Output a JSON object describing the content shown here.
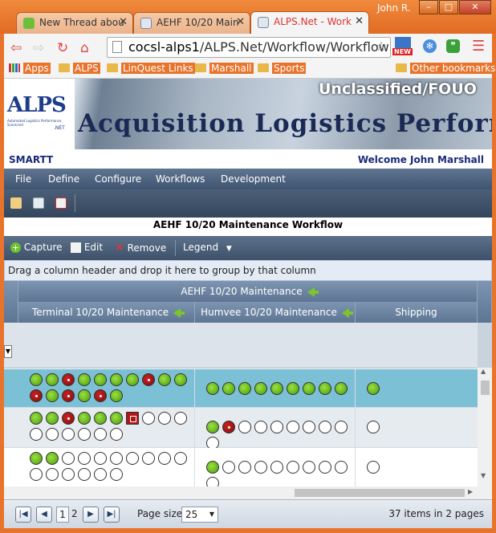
{
  "window": {
    "user": "John R.",
    "tabs": [
      {
        "title": "New Thread abou",
        "active": false
      },
      {
        "title": "AEHF 10/20 Main",
        "active": false
      },
      {
        "title": "ALPS.Net - Work",
        "active": true
      }
    ],
    "buttons": {
      "minimize": "–",
      "maximize": "□",
      "close": "✕"
    }
  },
  "browser": {
    "url_host": "cocsl-alps1",
    "url_path": "/ALPS.Net/Workflow/WorkflowP",
    "bookmarks": [
      "Apps",
      "ALPS",
      "LinQuest Links",
      "Marshall",
      "Sports"
    ],
    "other_bookmarks": "Other bookmarks",
    "new_badge": "NEW"
  },
  "banner": {
    "logo_text": "ALPS",
    "logo_sub": "Automated Logistics Performance Scorecard",
    "logo_net": ".NET",
    "classification": "Unclassified/FOUO",
    "title": "Acquisition Logistics Performa"
  },
  "app": {
    "name": "SMARTT",
    "welcome": "Welcome John Marshall"
  },
  "menu": [
    "File",
    "Define",
    "Configure",
    "Workflows",
    "Development"
  ],
  "workflow_title": "AEHF 10/20 Maintenance Workflow",
  "commands": {
    "capture": "Capture",
    "edit": "Edit",
    "remove": "Remove",
    "legend": "Legend"
  },
  "group_hint": "Drag a column header and drop it here to group by that column",
  "grid": {
    "group_header": "AEHF 10/20 Maintenance",
    "columns": [
      "Terminal 10/20 Maintenance",
      "Humvee 10/20 Maintenance",
      "Shipping"
    ],
    "rows": [
      {
        "selected": true,
        "terminal": [
          "g",
          "g",
          "r",
          "g",
          "g",
          "g",
          "g",
          "r",
          "g",
          "g",
          "r",
          "g",
          "r",
          "g",
          "r",
          "g"
        ],
        "humvee": [
          "g",
          "g",
          "g",
          "g",
          "g",
          "g",
          "g",
          "g",
          "g"
        ],
        "shipping": [
          "g"
        ]
      },
      {
        "selected": false,
        "terminal": [
          "g",
          "g",
          "r",
          "g",
          "g",
          "g",
          "sq",
          "w",
          "w",
          "w",
          "w",
          "w",
          "w",
          "w",
          "w",
          "w"
        ],
        "humvee": [
          "g",
          "r",
          "w",
          "w",
          "w",
          "w",
          "w",
          "w",
          "w",
          "w"
        ],
        "shipping": [
          "w"
        ]
      },
      {
        "selected": false,
        "terminal": [
          "g",
          "g",
          "w",
          "w",
          "w",
          "w",
          "w",
          "w",
          "w",
          "w",
          "w",
          "w",
          "w",
          "w",
          "w",
          "w"
        ],
        "humvee": [
          "g",
          "w",
          "w",
          "w",
          "w",
          "w",
          "w",
          "w",
          "w",
          "w"
        ],
        "shipping": [
          "w"
        ]
      }
    ]
  },
  "pager": {
    "page_current": "1",
    "page_next": "2",
    "page_size_label": "Page size:",
    "page_size": "25",
    "summary": "37 items in 2 pages"
  },
  "colors": {
    "accent": "#e8742c",
    "menu": "#4b607b",
    "selected_row": "#7cc0d6"
  }
}
